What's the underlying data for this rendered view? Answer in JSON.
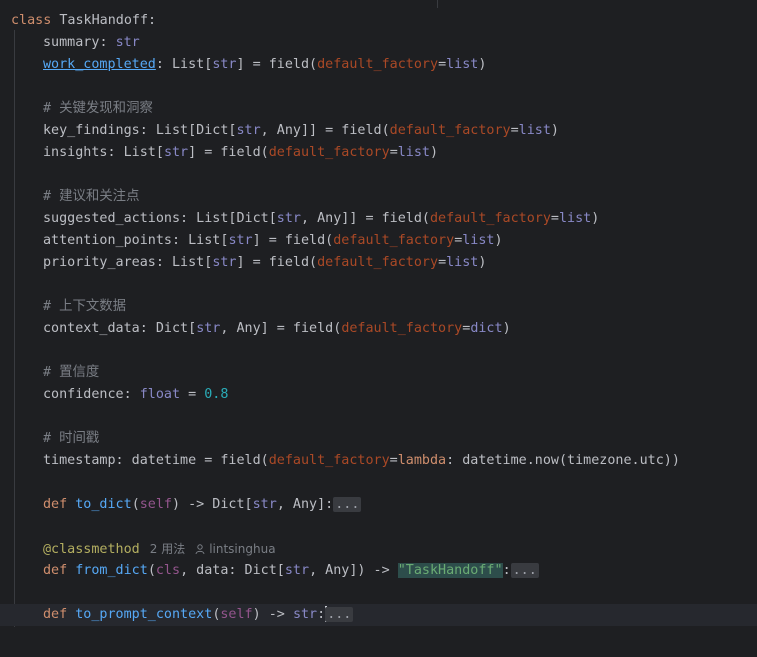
{
  "class_header": {
    "keyword": "class",
    "name": "TaskHandoff:"
  },
  "fields": {
    "summary": {
      "name": "summary",
      "colon": ": ",
      "type": "str"
    },
    "work_completed": {
      "name": "work_completed",
      "pre": ": List[",
      "type": "str",
      "mid": "] = field(",
      "param": "default_factory",
      "eq": "=",
      "value": "list",
      "end": ")"
    },
    "comment_findings": "# 关键发现和洞察",
    "key_findings": {
      "name": "key_findings: List[Dict[",
      "type": "str",
      "mid": ", Any]] = field(",
      "param": "default_factory",
      "eq": "=",
      "value": "list",
      "end": ")"
    },
    "insights": {
      "name": "insights: List[",
      "type": "str",
      "mid": "] = field(",
      "param": "default_factory",
      "eq": "=",
      "value": "list",
      "end": ")"
    },
    "comment_actions": "# 建议和关注点",
    "suggested_actions": {
      "name": "suggested_actions: List[Dict[",
      "type": "str",
      "mid": ", Any]] = field(",
      "param": "default_factory",
      "eq": "=",
      "value": "list",
      "end": ")"
    },
    "attention_points": {
      "name": "attention_points: List[",
      "type": "str",
      "mid": "] = field(",
      "param": "default_factory",
      "eq": "=",
      "value": "list",
      "end": ")"
    },
    "priority_areas": {
      "name": "priority_areas: List[",
      "type": "str",
      "mid": "] = field(",
      "param": "default_factory",
      "eq": "=",
      "value": "list",
      "end": ")"
    },
    "comment_context": "# 上下文数据",
    "context_data": {
      "name": "context_data: Dict[",
      "type": "str",
      "mid": ", Any] = field(",
      "param": "default_factory",
      "eq": "=",
      "value": "dict",
      "end": ")"
    },
    "comment_confidence": "# 置信度",
    "confidence": {
      "name": "confidence: ",
      "type": "float",
      "mid": " = ",
      "value": "0.8"
    },
    "comment_timestamp": "# 时间戳",
    "timestamp": {
      "name": "timestamp: datetime = field(",
      "param": "default_factory",
      "eq": "=",
      "kw": "lambda",
      "rest": ": datetime.now(timezone.utc))"
    }
  },
  "methods": {
    "to_dict": {
      "def": "def",
      "name": "to_dict",
      "open": "(",
      "self": "self",
      "sig": ") -> Dict[",
      "type": "str",
      "tail": ", Any]:",
      "collapsed": "..."
    },
    "decorator": {
      "name": "@classmethod",
      "usages": "2 用法",
      "author": "lintsinghua"
    },
    "from_dict": {
      "def": "def",
      "name": "from_dict",
      "open": "(",
      "cls": "cls",
      "sig": ", data: Dict[",
      "type": "str",
      "tail": ", Any]) -> ",
      "ret": "\"TaskHandoff\"",
      "colon": ":",
      "collapsed": "..."
    },
    "to_prompt_context": {
      "def": "def",
      "name": "to_prompt_context",
      "open": "(",
      "self": "self",
      "sig": ") -> ",
      "type": "str",
      "colon": ":",
      "collapsed": "..."
    }
  },
  "colors": {
    "background": "#1e1f22",
    "keyword": "#cf8e6d",
    "function": "#56a8f5",
    "builtin": "#8888c6",
    "param": "#aa4926",
    "number": "#2aacb8",
    "string": "#6aab73",
    "comment": "#7a7e85",
    "decorator": "#b3ae60"
  },
  "icons": [
    "user-icon",
    "caret"
  ]
}
